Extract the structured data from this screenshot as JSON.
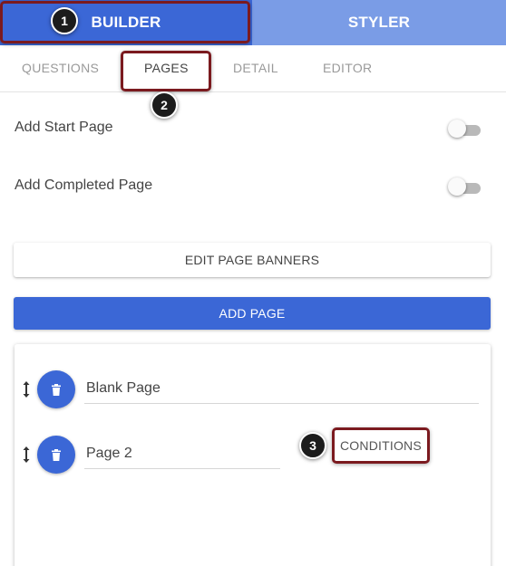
{
  "top_tabs": {
    "builder": "BUILDER",
    "styler": "STYLER"
  },
  "sub_tabs": {
    "questions": "QUESTIONS",
    "pages": "PAGES",
    "detail": "DETAIL",
    "editor": "EDITOR"
  },
  "settings": {
    "add_start_page": {
      "label": "Add Start Page",
      "enabled": false
    },
    "add_completed_page": {
      "label": "Add Completed Page",
      "enabled": false
    }
  },
  "buttons": {
    "edit_page_banners": "EDIT PAGE BANNERS",
    "add_page": "ADD PAGE"
  },
  "pages": [
    {
      "name": "Blank Page"
    },
    {
      "name": "Page 2",
      "conditions_label": "CONDITIONS"
    }
  ],
  "callouts": [
    "1",
    "2",
    "3"
  ],
  "colors": {
    "primary": "#3b67d6",
    "secondary_tab": "#7a9ce6",
    "callout_border": "#7b1a1f",
    "badge": "#1c1c1c"
  },
  "icons": {
    "drag": "drag-vertical-arrows-icon",
    "delete": "trash-icon"
  }
}
